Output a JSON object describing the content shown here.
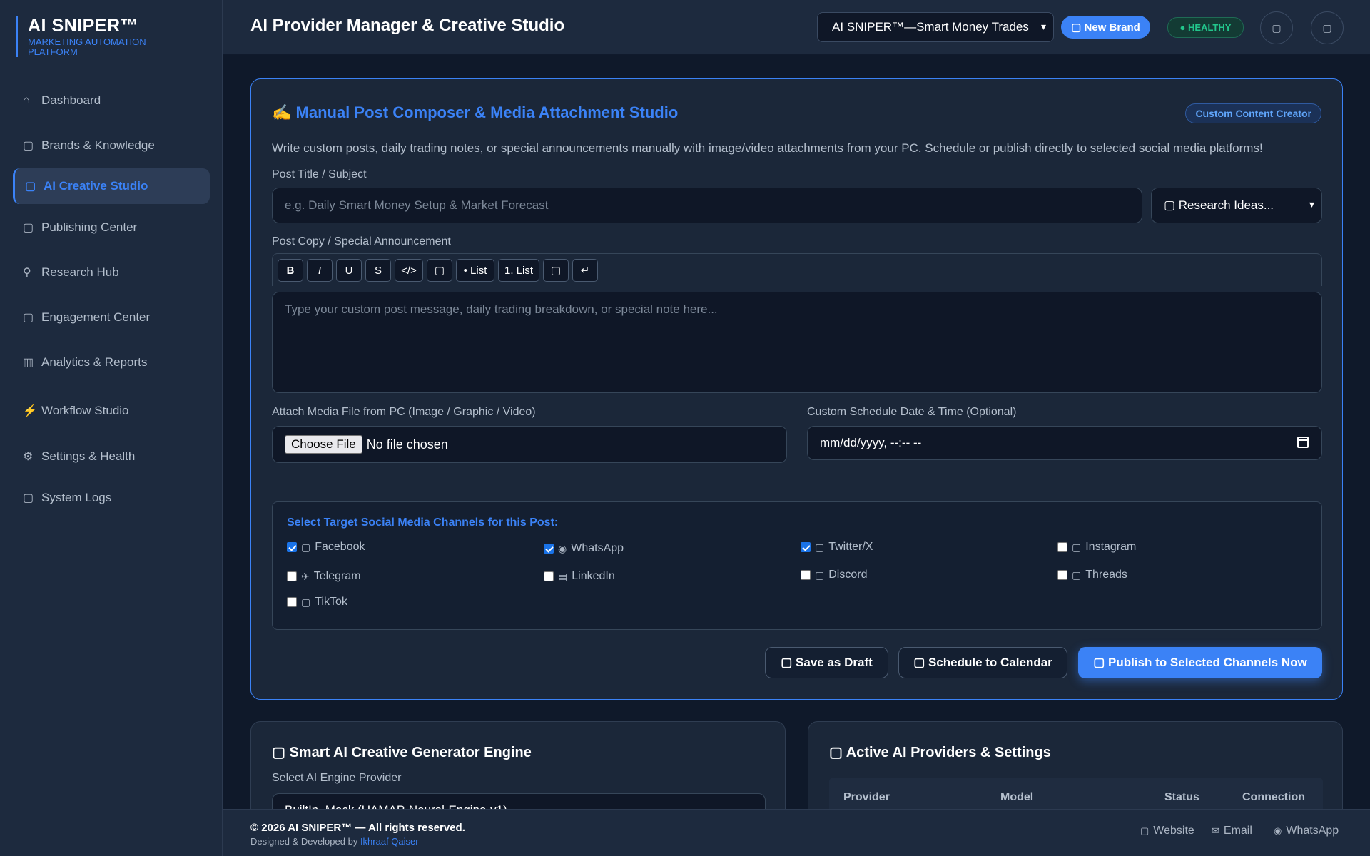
{
  "sidebar": {
    "brand_title": "AI SNIPER™",
    "brand_subtitle": "MARKETING AUTOMATION PLATFORM",
    "items": [
      {
        "label": "Dashboard",
        "icon": "⌂"
      },
      {
        "label": "Brands & Knowledge",
        "icon": "▢"
      },
      {
        "label": "AI Creative Studio",
        "icon": "▢",
        "active": true
      },
      {
        "label": "Publishing Center",
        "icon": "▢"
      },
      {
        "label": "Research Hub",
        "icon": "⚲"
      },
      {
        "label": "Engagement Center",
        "icon": "▢"
      },
      {
        "label": "Analytics & Reports",
        "icon": "▥"
      },
      {
        "label": "Workflow Studio",
        "icon": "⚡"
      },
      {
        "label": "Settings & Health",
        "icon": "⚙"
      },
      {
        "label": "System Logs",
        "icon": "▢"
      }
    ]
  },
  "header": {
    "title": "AI Provider Manager & Creative Studio",
    "brand_select_value": "AI SNIPER™—Smart Money Trades",
    "new_brand_label": "▢ New Brand",
    "health_label": "● HEALTHY",
    "icon_btn_1": "▢",
    "icon_btn_2": "▢"
  },
  "composer": {
    "title": "✍ Manual Post Composer & Media Attachment Studio",
    "badge": "Custom Content Creator",
    "description": "Write custom posts, daily trading notes, or special announcements manually with image/video attachments from your PC. Schedule or publish directly to selected social media platforms!",
    "title_label": "Post Title / Subject",
    "title_placeholder": "e.g. Daily Smart Money Setup & Market Forecast",
    "research_select": "▢ Research Ideas...",
    "copy_label": "Post Copy / Special Announcement",
    "toolbar": [
      "B",
      "I",
      "U",
      "S",
      "</>",
      "▢",
      "• List",
      "1. List",
      "▢",
      "↵"
    ],
    "copy_placeholder": "Type your custom post message, daily trading breakdown, or special note here...",
    "media_label": "Attach Media File from PC (Image / Graphic / Video)",
    "choose_file": "Choose File",
    "no_file": "No file chosen",
    "schedule_label": "Custom Schedule Date & Time (Optional)",
    "schedule_value": "mm/dd/yyyy, --:-- --",
    "channels_title": "Select Target Social Media Channels for this Post:",
    "channels": [
      {
        "name": "Facebook",
        "glyph": "▢",
        "checked": true
      },
      {
        "name": "WhatsApp",
        "glyph": "◉",
        "checked": true
      },
      {
        "name": "Twitter/X",
        "glyph": "▢",
        "checked": true
      },
      {
        "name": "Instagram",
        "glyph": "▢",
        "checked": false
      },
      {
        "name": "Telegram",
        "glyph": "✈",
        "checked": false
      },
      {
        "name": "LinkedIn",
        "glyph": "▤",
        "checked": false
      },
      {
        "name": "Discord",
        "glyph": "▢",
        "checked": false
      },
      {
        "name": "Threads",
        "glyph": "▢",
        "checked": false
      },
      {
        "name": "TikTok",
        "glyph": "▢",
        "checked": false
      }
    ],
    "save_draft": "▢ Save as Draft",
    "schedule_btn": "▢ Schedule to Calendar",
    "publish_btn": "▢ Publish to Selected Channels Now"
  },
  "generator_card": {
    "title": "▢ Smart AI Creative Generator Engine",
    "engine_label": "Select AI Engine Provider",
    "engine_value": "BuiltIn_Mock (UAMAP-Neural-Engine-v1)"
  },
  "providers_card": {
    "title": "▢ Active AI Providers & Settings",
    "columns": [
      "Provider",
      "Model",
      "Status",
      "Connection"
    ]
  },
  "footer": {
    "copyright": "© 2026 AI SNIPER™ — All rights reserved.",
    "credit_prefix": "Designed & Developed by ",
    "credit_name": "Ikhraaf Qaiser",
    "links": [
      {
        "label": "Website",
        "icon": "▢"
      },
      {
        "label": "Email",
        "icon": "✉"
      },
      {
        "label": "WhatsApp",
        "icon": "◉"
      }
    ]
  },
  "colors": {
    "accent": "#3b82f6",
    "background": "#101a2c",
    "panel": "#1b2739",
    "healthy": "#22c58b"
  }
}
